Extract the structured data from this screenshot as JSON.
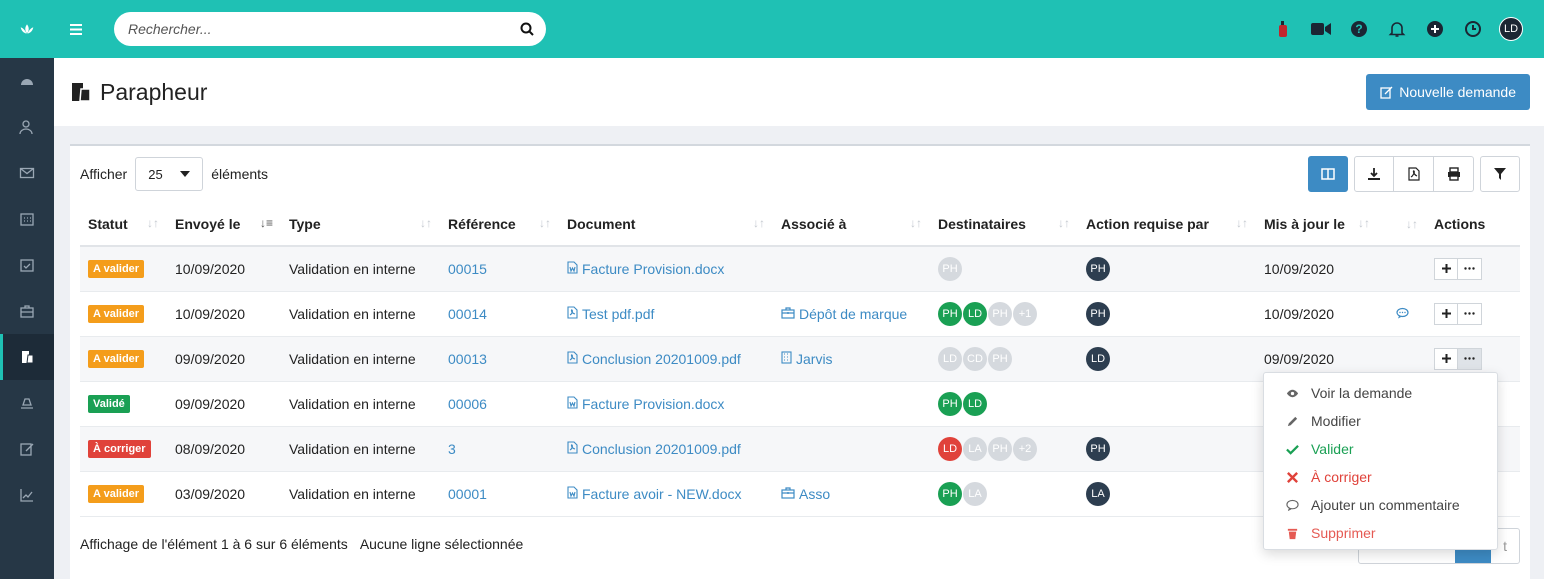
{
  "search": {
    "placeholder": "Rechercher..."
  },
  "topbar": {
    "avatar": "LD"
  },
  "page": {
    "title": "Parapheur",
    "new_button": "Nouvelle demande"
  },
  "length": {
    "prefix": "Afficher",
    "value": "25",
    "suffix": "éléments"
  },
  "columns": [
    "Statut",
    "Envoyé le",
    "Type",
    "Référence",
    "Document",
    "Associé à",
    "Destinataires",
    "Action requise par",
    "Mis à jour le",
    "",
    "Actions"
  ],
  "rows": [
    {
      "status": "A valider",
      "status_color": "#f49d1b",
      "sent": "10/09/2020",
      "type": "Validation en interne",
      "ref": "00015",
      "doc": "Facture Provision.docx",
      "doc_icon": "word-file-icon",
      "assoc": "",
      "assoc_icon": "",
      "dest": [
        {
          "t": "PH",
          "c": "grey"
        }
      ],
      "action_by": "PH",
      "updated": "10/09/2020",
      "comment": false
    },
    {
      "status": "A valider",
      "status_color": "#f49d1b",
      "sent": "10/09/2020",
      "type": "Validation en interne",
      "ref": "00014",
      "doc": "Test pdf.pdf",
      "doc_icon": "pdf-file-icon",
      "assoc": "Dépôt de marque",
      "assoc_icon": "briefcase-icon",
      "dest": [
        {
          "t": "PH",
          "c": "green"
        },
        {
          "t": "LD",
          "c": "green"
        },
        {
          "t": "PH",
          "c": "grey"
        },
        {
          "t": "+1",
          "c": "grey"
        }
      ],
      "action_by": "PH",
      "updated": "10/09/2020",
      "comment": true
    },
    {
      "status": "A valider",
      "status_color": "#f49d1b",
      "sent": "09/09/2020",
      "type": "Validation en interne",
      "ref": "00013",
      "doc": "Conclusion 20201009.pdf",
      "doc_icon": "pdf-file-icon",
      "assoc": "Jarvis",
      "assoc_icon": "building-icon",
      "dest": [
        {
          "t": "LD",
          "c": "grey"
        },
        {
          "t": "CD",
          "c": "grey"
        },
        {
          "t": "PH",
          "c": "grey"
        }
      ],
      "action_by": "LD",
      "updated": "09/09/2020",
      "comment": false
    },
    {
      "status": "Validé",
      "status_color": "#1aa054",
      "sent": "09/09/2020",
      "type": "Validation en interne",
      "ref": "00006",
      "doc": "Facture Provision.docx",
      "doc_icon": "word-file-icon",
      "assoc": "",
      "assoc_icon": "",
      "dest": [
        {
          "t": "PH",
          "c": "green"
        },
        {
          "t": "LD",
          "c": "green"
        }
      ],
      "action_by": "",
      "updated": "",
      "comment": false
    },
    {
      "status": "À corriger",
      "status_color": "#e0423a",
      "sent": "08/09/2020",
      "type": "Validation en interne",
      "ref": "3",
      "doc": "Conclusion 20201009.pdf",
      "doc_icon": "pdf-file-icon",
      "assoc": "",
      "assoc_icon": "",
      "dest": [
        {
          "t": "LD",
          "c": "red"
        },
        {
          "t": "LA",
          "c": "grey"
        },
        {
          "t": "PH",
          "c": "grey"
        },
        {
          "t": "+2",
          "c": "grey"
        }
      ],
      "action_by": "PH",
      "updated": "",
      "comment": false
    },
    {
      "status": "A valider",
      "status_color": "#f49d1b",
      "sent": "03/09/2020",
      "type": "Validation en interne",
      "ref": "00001",
      "doc": "Facture avoir - NEW.docx",
      "doc_icon": "word-file-icon",
      "assoc": "Asso",
      "assoc_icon": "briefcase-icon",
      "dest": [
        {
          "t": "PH",
          "c": "green"
        },
        {
          "t": "LA",
          "c": "grey"
        }
      ],
      "action_by": "LA",
      "updated": "",
      "comment": false
    }
  ],
  "footer": {
    "info": "Affichage de l'élément 1 à 6 sur 6 éléments",
    "selection": "Aucune ligne sélectionnée",
    "pager_next": "t"
  },
  "dropdown": [
    {
      "label": "Voir la demande",
      "icon": "eye-icon",
      "tone": "default"
    },
    {
      "label": "Modifier",
      "icon": "pencil-icon",
      "tone": "default"
    },
    {
      "label": "Valider",
      "icon": "check-icon",
      "tone": "green"
    },
    {
      "label": "À corriger",
      "icon": "x-icon",
      "tone": "red"
    },
    {
      "label": "Ajouter un commentaire",
      "icon": "comment-icon",
      "tone": "default"
    },
    {
      "label": "Supprimer",
      "icon": "trash-icon",
      "tone": "lightred"
    }
  ]
}
